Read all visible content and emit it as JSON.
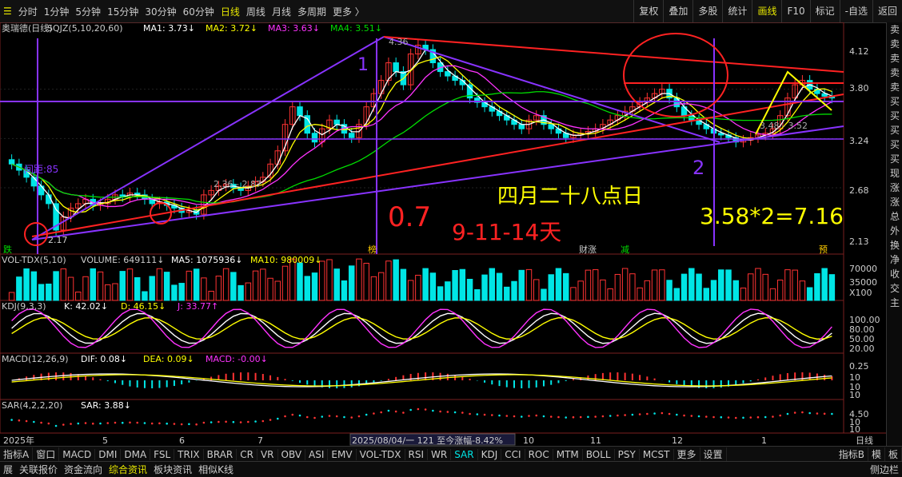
{
  "toolbar": {
    "periods": [
      "分时",
      "1分钟",
      "5分钟",
      "15分钟",
      "30分钟",
      "60分钟",
      "日线",
      "周线",
      "月线",
      "多周期",
      "更多 〉"
    ],
    "active_period": "日线",
    "right_buttons": [
      "复权",
      "叠加",
      "多股",
      "统计",
      "画线",
      "F10",
      "标记",
      "-自选",
      "返回"
    ],
    "active_right": "画线"
  },
  "main_legend": {
    "title": "奥瑞德(日线)",
    "indicator": "SQJZ(5,10,20,60)",
    "ma1": "MA1: 3.73↓",
    "ma2": "MA2: 3.72↓",
    "ma3": "MA3: 3.63↓",
    "ma4": "MA4: 3.51↓"
  },
  "vol_legend": {
    "name": "VOL-TDX(5,10)",
    "volume": "VOLUME: 649111↓",
    "ma5": "MA5: 1075936↓",
    "ma10": "MA10: 980009↓"
  },
  "kdj_legend": {
    "name": "KDJ(9,3,3)",
    "k": "K: 42.02↓",
    "d": "D: 46.15↓",
    "j": "J: 33.77↑"
  },
  "macd_legend": {
    "name": "MACD(12,26,9)",
    "dif": "DIF: 0.08↓",
    "dea": "DEA: 0.09↓",
    "macd": "MACD: -0.00↓"
  },
  "sar_legend": {
    "name": "SAR(4,2,2,20)",
    "sar": "SAR: 3.88↓"
  },
  "price_axis": [
    "4.12",
    "3.80",
    "3.24",
    "2.68",
    "2.13"
  ],
  "vol_axis": [
    "70000",
    "35000",
    "X100"
  ],
  "kdj_axis": [
    "100.00",
    "80.00",
    "50.00",
    "20.00"
  ],
  "macd_axis": [
    "0.25",
    "10",
    "10",
    "10"
  ],
  "sar_axis": [
    "4.50",
    "10",
    "10"
  ],
  "date_axis": [
    {
      "label": "2025年"
    },
    {
      "label": "5"
    },
    {
      "label": "6"
    },
    {
      "label": "7"
    },
    {
      "label": "2025/08/04/一 121 至今涨幅-8.42%"
    },
    {
      "label": "10"
    },
    {
      "label": "11"
    },
    {
      "label": "12"
    },
    {
      "label": "1"
    }
  ],
  "date_axis_right": "日线",
  "annotations": {
    "price_236": "2.36 - 2.87",
    "price_448": "3.48 - 3.52",
    "price_217": "2.17",
    "gap_label": "间距:85",
    "num_1": "1",
    "num_2": "2",
    "num_07": "0.7",
    "days": "9-11-14天",
    "date_text": "四月二十八点日",
    "formula": "3.58*2=7.16",
    "tag_die": "跌",
    "tag_bang": "榜",
    "tag_caizhang": "财涨",
    "tag_jian": "减",
    "tag_yu": "预",
    "top_price": "4.36"
  },
  "sidebar": {
    "chars": [
      "卖",
      "卖",
      "卖",
      "卖",
      "卖",
      "买",
      "买",
      "买",
      "买",
      "买",
      "现",
      "涨",
      "涨",
      "总",
      "外",
      "换",
      "净",
      "收",
      "交",
      "主"
    ]
  },
  "indicator_tabs": [
    "指标A",
    "窗口",
    "MACD",
    "DMI",
    "DMA",
    "FSL",
    "TRIX",
    "BRAR",
    "CR",
    "VR",
    "OBV",
    "ASI",
    "EMV",
    "VOL-TDX",
    "RSI",
    "WR",
    "SAR",
    "KDJ",
    "CCI",
    "ROC",
    "MTM",
    "BOLL",
    "PSY",
    "MCST",
    "更多",
    "设置"
  ],
  "active_indicator": "SAR",
  "indicator_right": [
    "指标B",
    "模",
    "板"
  ],
  "bottom_tabs": [
    "展",
    "关联报价",
    "资金流向",
    "综合资讯",
    "板块资讯",
    "相似K线"
  ],
  "active_bottom": "综合资讯",
  "bottom_right": "侧边栏",
  "colors": {
    "up": "#ff3333",
    "down": "#00e5e5",
    "ma1": "#ffffff",
    "ma2": "#ffff00",
    "ma3": "#ff33ff",
    "ma4": "#00dd00",
    "trend_red": "#ff2222",
    "trend_purple": "#8833ff"
  },
  "chart_data": {
    "type": "candlestick",
    "series": [
      {
        "name": "close",
        "values": [
          2.95,
          2.88,
          2.8,
          2.7,
          2.6,
          2.5,
          2.2,
          2.35,
          2.45,
          2.5,
          2.55,
          2.48,
          2.5,
          2.55,
          2.6,
          2.58,
          2.62,
          2.6,
          2.55,
          2.5,
          2.52,
          2.48,
          2.45,
          2.4,
          2.42,
          2.38,
          2.6,
          2.65,
          2.7,
          2.72,
          2.68,
          2.65,
          2.7,
          2.75,
          2.8,
          2.95,
          3.1,
          3.4,
          3.6,
          3.5,
          3.3,
          3.2,
          3.35,
          3.45,
          3.4,
          3.3,
          3.25,
          3.4,
          3.6,
          3.75,
          3.9,
          4.1,
          4.0,
          3.85,
          4.2,
          4.3,
          4.25,
          4.1,
          4.0,
          3.95,
          3.9,
          3.85,
          3.7,
          3.65,
          3.6,
          3.55,
          3.5,
          3.45,
          3.4,
          3.35,
          3.45,
          3.5,
          3.4,
          3.35,
          3.3,
          3.25,
          3.28,
          3.3,
          3.32,
          3.35,
          3.4,
          3.45,
          3.5,
          3.55,
          3.6,
          3.65,
          3.7,
          3.75,
          3.8,
          3.7,
          3.6,
          3.5,
          3.45,
          3.4,
          3.35,
          3.3,
          3.28,
          3.25,
          3.2,
          3.22,
          3.25,
          3.28,
          3.3,
          3.35,
          3.5,
          3.7,
          3.85,
          3.9,
          3.8,
          3.75,
          3.72,
          3.7
        ]
      }
    ]
  }
}
